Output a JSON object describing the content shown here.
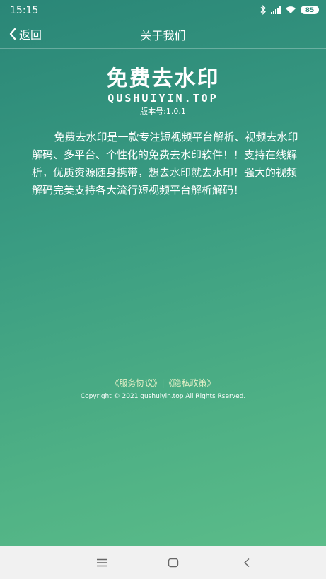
{
  "status_bar": {
    "time": "15:15",
    "battery": "85",
    "icons": [
      "bluetooth-icon",
      "signal-icon",
      "wifi-icon",
      "battery-icon"
    ]
  },
  "header": {
    "back_label": "返回",
    "title": "关于我们"
  },
  "logo": {
    "title": "免费去水印",
    "subtitle": "QUSHUIYIN.TOP"
  },
  "version": "版本号:1.0.1",
  "description": "免费去水印是一款专注短视频平台解析、视频去水印解码、多平台、个性化的免费去水印软件！！支持在线解析，优质资源随身携带，想去水印就去水印！强大的视频解码完美支持各大流行短视频平台解析解码！",
  "footer": {
    "service_agreement": "《服务协议》",
    "separator": "|",
    "privacy_policy": "《隐私政策》",
    "copyright": "Copyright © 2021 qushuiyin.top All Rights Rserved."
  },
  "nav_bar": {
    "icons": [
      "menu-icon",
      "home-icon",
      "back-nav-icon"
    ]
  },
  "colors": {
    "gradient_top": "#2a8677",
    "gradient_bottom": "#5bbc89",
    "link": "#e3efc6"
  }
}
